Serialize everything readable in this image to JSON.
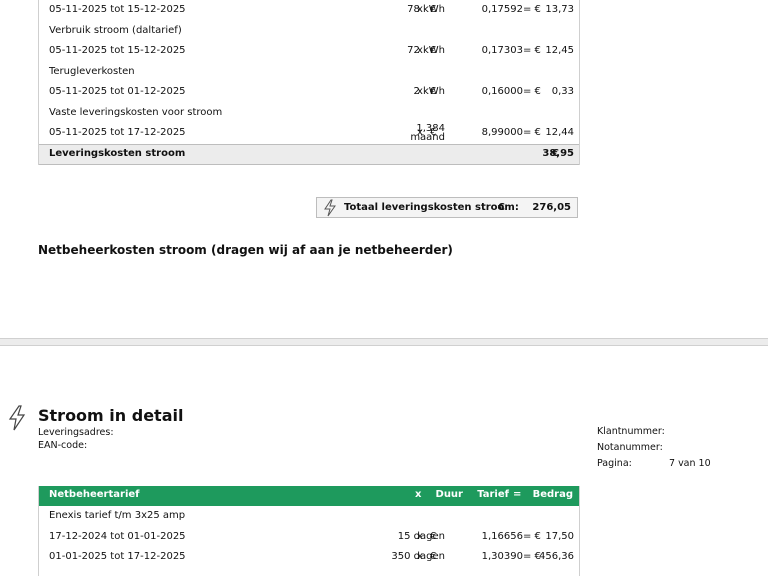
{
  "page1": {
    "rows": [
      {
        "type": "item",
        "label": "05-11-2025 tot 15-12-2025",
        "qty": "78 kWh",
        "x": "x",
        "eur": "€",
        "rate": "0,17592",
        "eq": "= €",
        "amount": "13,73"
      },
      {
        "type": "label",
        "label": "Verbruik stroom (daltarief)"
      },
      {
        "type": "item",
        "label": "05-11-2025 tot 15-12-2025",
        "qty": "72 kWh",
        "x": "x",
        "eur": "€",
        "rate": "0,17303",
        "eq": "= €",
        "amount": "12,45"
      },
      {
        "type": "label",
        "label": "Terugleverkosten"
      },
      {
        "type": "item",
        "label": "05-11-2025 tot 01-12-2025",
        "qty": "2 kWh",
        "x": "x",
        "eur": "€",
        "rate": "0,16000",
        "eq": "= €",
        "amount": "0,33"
      },
      {
        "type": "label",
        "label": "Vaste leveringskosten voor stroom"
      },
      {
        "type": "item2",
        "label": "05-11-2025 tot 17-12-2025",
        "qty_top": "1,384",
        "qty_bottom": "maand",
        "x": "x",
        "eur": "€",
        "rate": "8,99000",
        "eq": "= €",
        "amount": "12,44"
      }
    ],
    "subtotal": {
      "label": "Leveringskosten stroom",
      "eur": "€",
      "amount": "38,95"
    },
    "total": {
      "label": "Totaal leveringskosten stroom:",
      "eur": "€",
      "amount": "276,05"
    },
    "next_heading": "Netbeheerkosten stroom (dragen wij af aan je netbeheerder)"
  },
  "page2": {
    "title": "Stroom in detail",
    "address_label": "Leveringsadres:",
    "ean_label": "EAN-code:",
    "info": [
      {
        "label": "Klantnummer:",
        "value": ""
      },
      {
        "label": "Notanummer:",
        "value": ""
      },
      {
        "label": "Pagina:",
        "value": "7 van 10"
      }
    ],
    "table": {
      "headers": {
        "name": "Netbeheertarief",
        "duur": "Duur",
        "x": "x",
        "tarief": "Tarief",
        "eq": "=",
        "bedrag": "Bedrag"
      },
      "group_label": "Enexis tarief t/m 3x25 amp",
      "rows": [
        {
          "label": "17-12-2024 tot 01-01-2025",
          "qty": "15 dagen",
          "x": "x",
          "eur": "€",
          "rate": "1,16656",
          "eq": "= €",
          "amount": "17,50"
        },
        {
          "label": "01-01-2025 tot 17-12-2025",
          "qty": "350 dagen",
          "x": "x",
          "eur": "€",
          "rate": "1,30390",
          "eq": "= €",
          "amount": "456,36"
        }
      ]
    }
  },
  "colors": {
    "header_green": "#1e9a5d",
    "subtotal_gray": "#ececec"
  },
  "icons": [
    "lightning-bolt-icon"
  ]
}
